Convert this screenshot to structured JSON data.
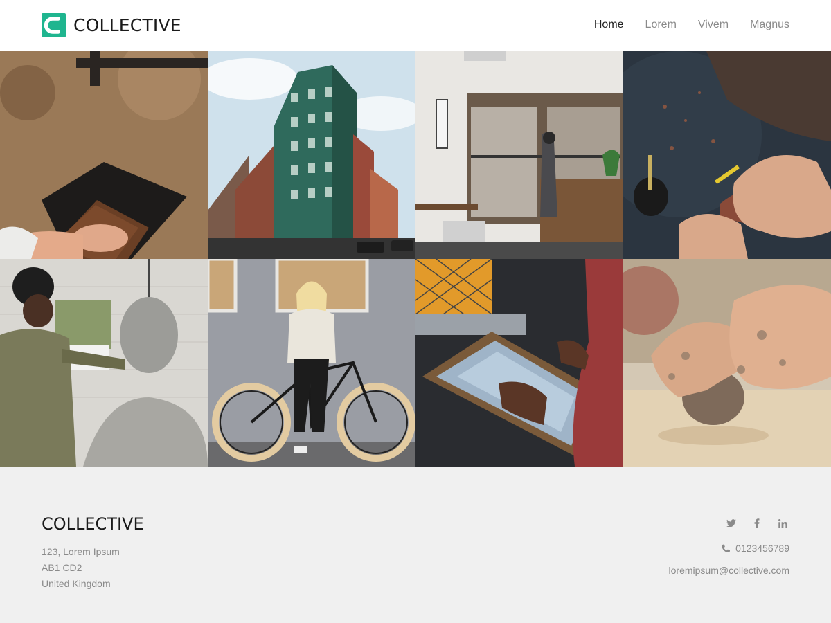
{
  "site": {
    "brand": "COLLECTIVE",
    "accent_color": "#1fb58f",
    "logo_icon": "check-mark-icon"
  },
  "nav": {
    "items": [
      {
        "label": "Home",
        "active": true
      },
      {
        "label": "Lorem",
        "active": false
      },
      {
        "label": "Vivem",
        "active": false
      },
      {
        "label": "Magnus",
        "active": false
      }
    ]
  },
  "gallery": {
    "tiles": [
      {
        "subject": "woodworking-sanding"
      },
      {
        "subject": "green-bay-window-building"
      },
      {
        "subject": "studio-workspace"
      },
      {
        "subject": "wood-carving"
      },
      {
        "subject": "sculptor-with-bust"
      },
      {
        "subject": "woman-with-bicycle"
      },
      {
        "subject": "screen-printing"
      },
      {
        "subject": "clay-pottery-hands"
      }
    ]
  },
  "footer": {
    "brand": "COLLECTIVE",
    "address": [
      "123, Lorem Ipsum",
      "AB1 CD2",
      "United Kingdom"
    ],
    "socials": [
      "twitter-icon",
      "facebook-icon",
      "linkedin-icon"
    ],
    "phone_icon": "phone-icon",
    "phone": "0123456789",
    "email": "loremipsum@collective.com"
  }
}
